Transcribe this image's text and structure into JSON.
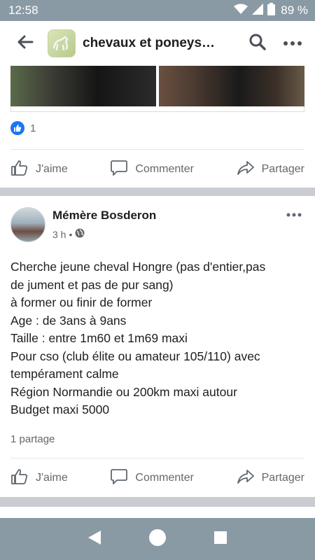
{
  "status_bar": {
    "time": "12:58",
    "battery": "89 %"
  },
  "app_bar": {
    "group_title": "chevaux et poneys…"
  },
  "post1": {
    "reaction_count": "1",
    "actions": {
      "like": "J'aime",
      "comment": "Commenter",
      "share": "Partager"
    }
  },
  "post2": {
    "author": "Mémère Bosderon",
    "time": "3 h",
    "meta_sep": "•",
    "body_lines": [
      "Cherche jeune cheval Hongre (pas d'entier,pas",
      "de jument et pas de pur sang)",
      "à former ou finir de former",
      "Age : de 3ans à 9ans",
      "Taille : entre 1m60 et 1m69 maxi",
      "Pour cso (club élite ou amateur 105/110) avec",
      "tempérament calme",
      "Région Normandie ou 200km maxi autour",
      "Budget maxi 5000"
    ],
    "shares": "1 partage",
    "actions": {
      "like": "J'aime",
      "comment": "Commenter",
      "share": "Partager"
    }
  },
  "icons": {
    "back": "back-arrow-icon",
    "search": "search-icon",
    "more": "more-dots-icon",
    "globe": "globe-icon",
    "like": "thumbs-up-icon",
    "comment": "comment-bubble-icon",
    "share": "share-arrow-icon"
  },
  "colors": {
    "status_bar": "#8a9aa5",
    "like_blue": "#1877f2",
    "secondary_text": "#65676b",
    "separator": "#c9ccd1"
  }
}
